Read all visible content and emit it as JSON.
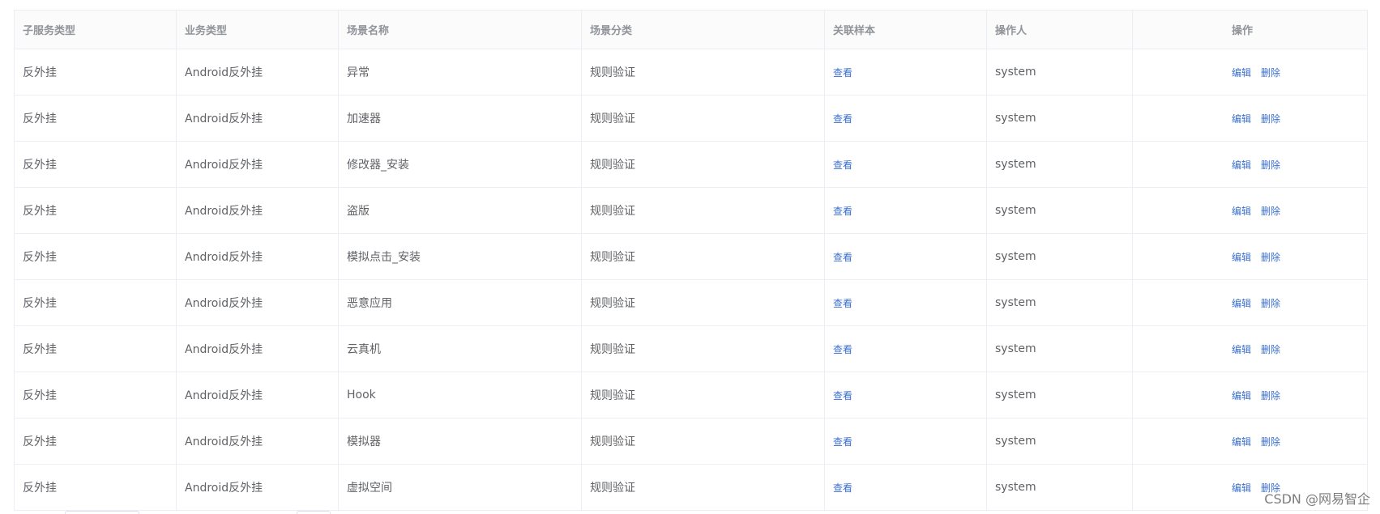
{
  "table": {
    "columns": [
      "子服务类型",
      "业务类型",
      "场景名称",
      "场景分类",
      "关联样本",
      "操作人",
      "操作"
    ],
    "rows": [
      {
        "sub_service": "反外挂",
        "business": "Android反外挂",
        "scene": "异常",
        "category": "规则验证",
        "sample_link": "查看",
        "operator": "system",
        "edit": "编辑",
        "delete": "删除"
      },
      {
        "sub_service": "反外挂",
        "business": "Android反外挂",
        "scene": "加速器",
        "category": "规则验证",
        "sample_link": "查看",
        "operator": "system",
        "edit": "编辑",
        "delete": "删除"
      },
      {
        "sub_service": "反外挂",
        "business": "Android反外挂",
        "scene": "修改器_安装",
        "category": "规则验证",
        "sample_link": "查看",
        "operator": "system",
        "edit": "编辑",
        "delete": "删除"
      },
      {
        "sub_service": "反外挂",
        "business": "Android反外挂",
        "scene": "盗版",
        "category": "规则验证",
        "sample_link": "查看",
        "operator": "system",
        "edit": "编辑",
        "delete": "删除"
      },
      {
        "sub_service": "反外挂",
        "business": "Android反外挂",
        "scene": "模拟点击_安装",
        "category": "规则验证",
        "sample_link": "查看",
        "operator": "system",
        "edit": "编辑",
        "delete": "删除"
      },
      {
        "sub_service": "反外挂",
        "business": "Android反外挂",
        "scene": "恶意应用",
        "category": "规则验证",
        "sample_link": "查看",
        "operator": "system",
        "edit": "编辑",
        "delete": "删除"
      },
      {
        "sub_service": "反外挂",
        "business": "Android反外挂",
        "scene": "云真机",
        "category": "规则验证",
        "sample_link": "查看",
        "operator": "system",
        "edit": "编辑",
        "delete": "删除"
      },
      {
        "sub_service": "反外挂",
        "business": "Android反外挂",
        "scene": "Hook",
        "category": "规则验证",
        "sample_link": "查看",
        "operator": "system",
        "edit": "编辑",
        "delete": "删除"
      },
      {
        "sub_service": "反外挂",
        "business": "Android反外挂",
        "scene": "模拟器",
        "category": "规则验证",
        "sample_link": "查看",
        "operator": "system",
        "edit": "编辑",
        "delete": "删除"
      },
      {
        "sub_service": "反外挂",
        "business": "Android反外挂",
        "scene": "虚拟空间",
        "category": "规则验证",
        "sample_link": "查看",
        "operator": "system",
        "edit": "编辑",
        "delete": "删除"
      }
    ]
  },
  "watermark": "CSDN @网易智企",
  "colors": {
    "link": "#3a6fcf",
    "border": "#ebeef5",
    "header_text": "#909399",
    "cell_text": "#606266"
  }
}
